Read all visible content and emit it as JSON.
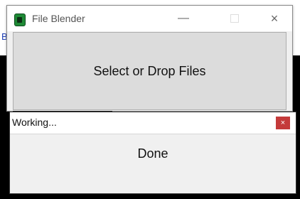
{
  "background": {
    "letter": "B"
  },
  "main_window": {
    "title": "File Blender",
    "minimize_glyph": "—",
    "close_glyph": "×",
    "drop_label": "Select or Drop Files"
  },
  "dialog": {
    "title": "Working...",
    "close_glyph": "×",
    "status": "Done"
  },
  "colors": {
    "app_icon": "#1f8a36",
    "dialog_close_bg": "#c43a3a",
    "drop_area_bg": "#dcdcdc"
  },
  "icons": [
    "app-icon",
    "minimize-icon",
    "maximize-icon",
    "close-icon",
    "dialog-close-icon"
  ]
}
